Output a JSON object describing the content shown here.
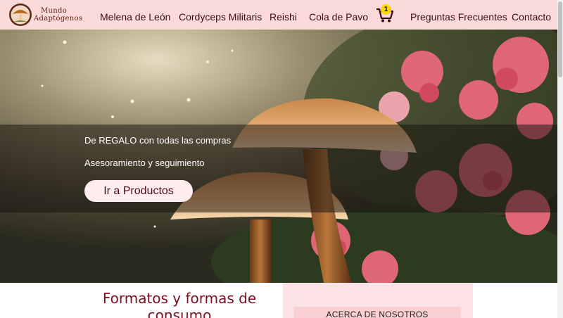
{
  "brand": {
    "line1": "Mundo",
    "line2": "Adaptógenos"
  },
  "nav": {
    "items": [
      "Melena de León",
      "Cordyceps Militaris",
      "Reishi",
      "Cola de Pavo",
      "Preguntas Frecuentes",
      "Contacto"
    ],
    "cart_count": "1"
  },
  "hero": {
    "promo_line1": "De REGALO con todas las compras",
    "promo_line2": "Asesoramiento y seguimiento",
    "cta_label": "Ir a Productos"
  },
  "section": {
    "title": "Formatos y formas de consumo",
    "about_label": "ACERCA DE NOSOTROS"
  },
  "colors": {
    "header_bg": "#fbdada",
    "nav_text": "#3d0d12",
    "cta_bg": "#ffeded",
    "title_color": "#7a1020",
    "cart_badge": "#ffd700"
  },
  "icons": {
    "logo": "mushroom-logo-icon",
    "cart": "shopping-cart-icon"
  }
}
